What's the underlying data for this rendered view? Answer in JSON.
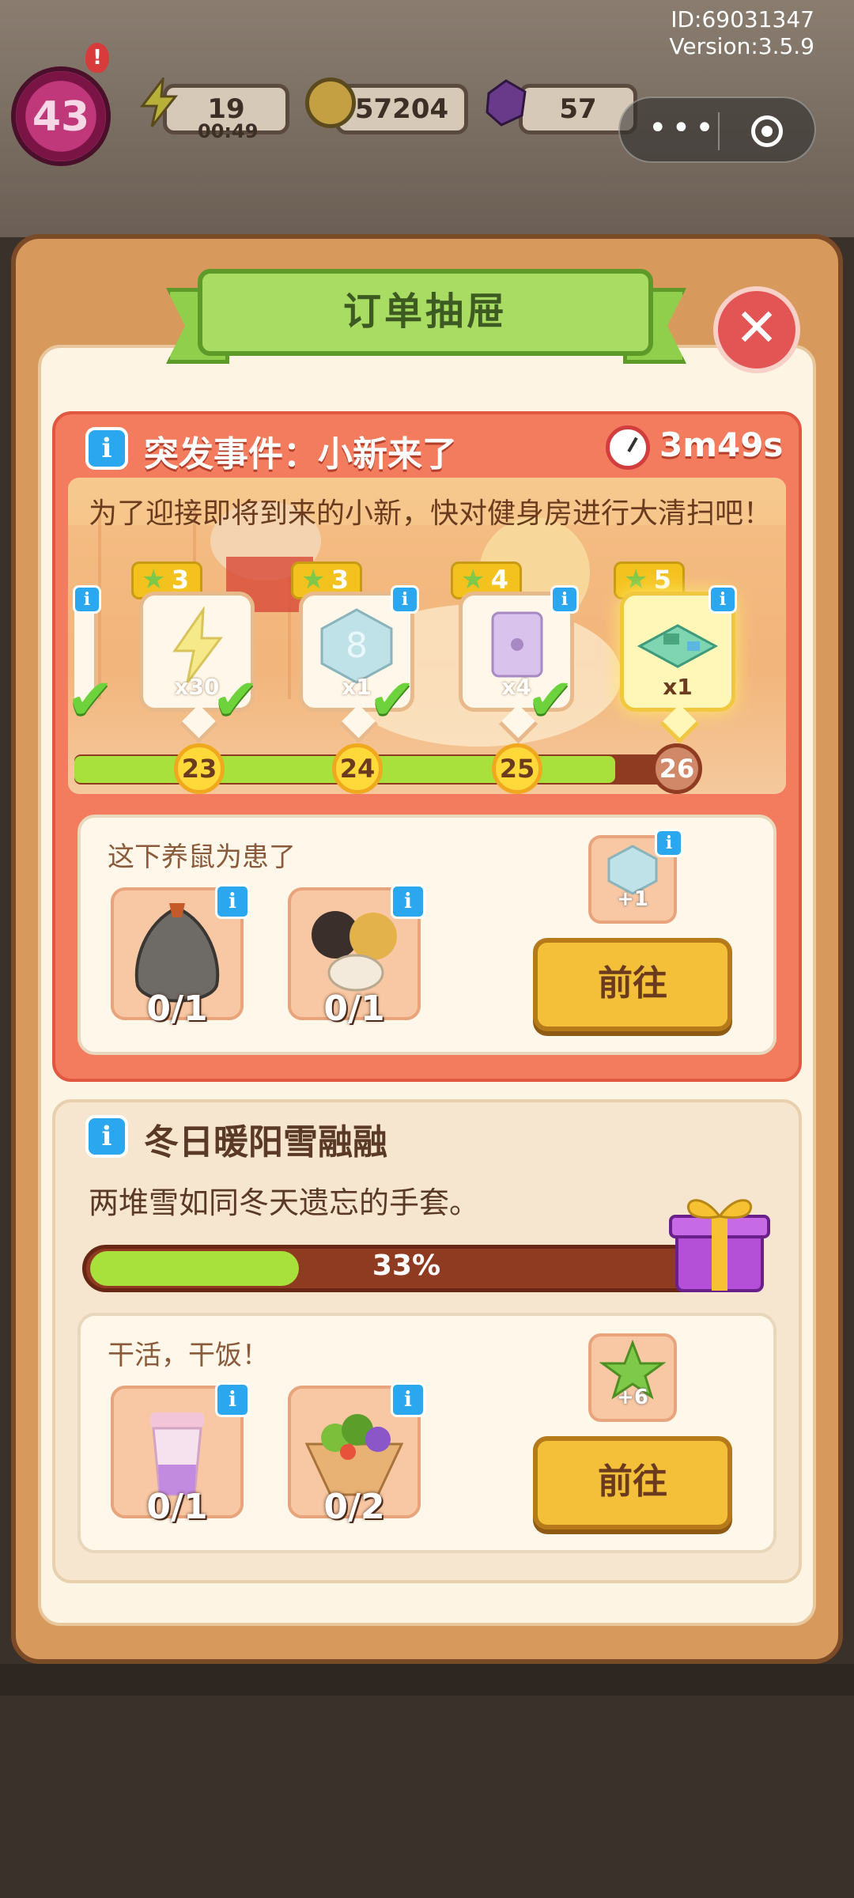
{
  "hud": {
    "id_text": "ID:69031347",
    "version_text": "Version:3.5.9",
    "level": "43",
    "alert": "!",
    "energy": "19",
    "energy_timer": "00:49",
    "coins": "57204",
    "gems": "57"
  },
  "dialog": {
    "title": "订单抽屉",
    "close_icon": "close-icon"
  },
  "event": {
    "title": "突发事件：小新来了",
    "timer": "3m49s",
    "description": "为了迎接即将到来的小新，快对健身房进行大清扫吧！",
    "rewards": [
      {
        "stars": "3",
        "qty": "x30",
        "icon": "lightning-icon",
        "claimed": true,
        "level": "23"
      },
      {
        "stars": "3",
        "qty": "x1",
        "icon": "hourglass-icon",
        "claimed": true,
        "level": "24"
      },
      {
        "stars": "4",
        "qty": "x4",
        "icon": "safe-icon",
        "claimed": true,
        "level": "25"
      },
      {
        "stars": "5",
        "qty": "x1",
        "icon": "gym-room-icon",
        "claimed": false,
        "level": "26"
      }
    ],
    "progress": 0.9,
    "task": {
      "title": "这下养鼠为患了",
      "items": [
        {
          "icon": "garbage-bag-icon",
          "count": "0/1"
        },
        {
          "icon": "hamsters-icon",
          "count": "0/1"
        }
      ],
      "reward_count": "+1",
      "go_label": "前往"
    }
  },
  "winter": {
    "title": "冬日暖阳雪融融",
    "description": "两堆雪如同冬天遗忘的手套。",
    "progress_label": "33%",
    "progress": 0.33,
    "task": {
      "title": "干活，干饭！",
      "items": [
        {
          "icon": "shaker-bottle-icon",
          "count": "0/1"
        },
        {
          "icon": "salad-icon",
          "count": "0/2"
        }
      ],
      "reward_count": "+6",
      "go_label": "前往"
    }
  },
  "colors": {
    "event_bg": "#f37c5e",
    "go_button": "#f4c03a",
    "progress_fill": "#a8e03c",
    "info_icon": "#2aa7ee"
  }
}
